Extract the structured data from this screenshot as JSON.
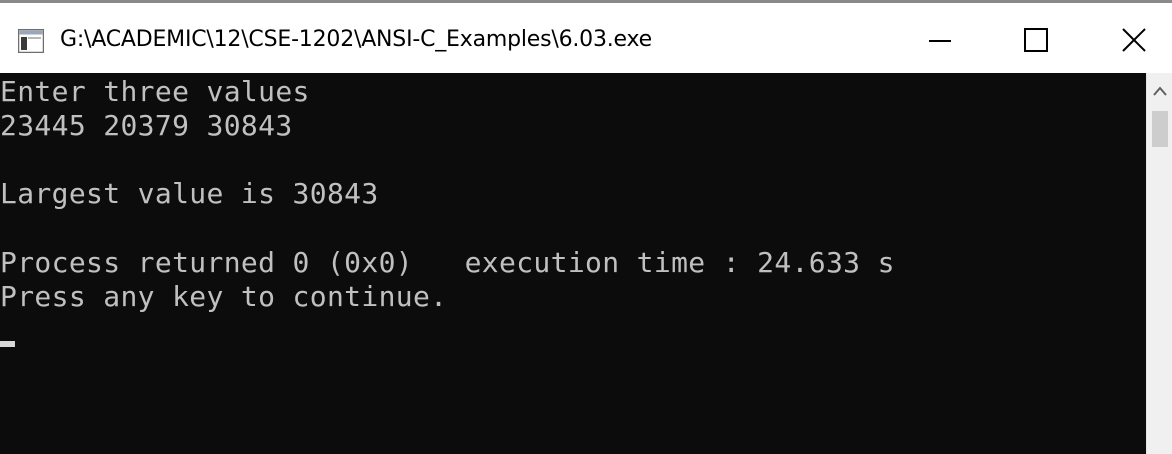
{
  "window": {
    "title": "G:\\ACADEMIC\\12\\CSE-1202\\ANSI-C_Examples\\6.03.exe",
    "icon": "console-app-icon",
    "controls": {
      "minimize_icon": "minimize-icon",
      "maximize_icon": "maximize-icon",
      "close_icon": "close-icon"
    }
  },
  "console": {
    "background": "#0c0c0c",
    "foreground": "#c0c0c0",
    "lines": [
      "Enter three values",
      "23445 20379 30843",
      "",
      "Largest value is 30843",
      "",
      "Process returned 0 (0x0)   execution time : 24.633 s",
      "Press any key to continue."
    ]
  },
  "scrollbar": {
    "up_icon": "chevron-up-icon"
  }
}
